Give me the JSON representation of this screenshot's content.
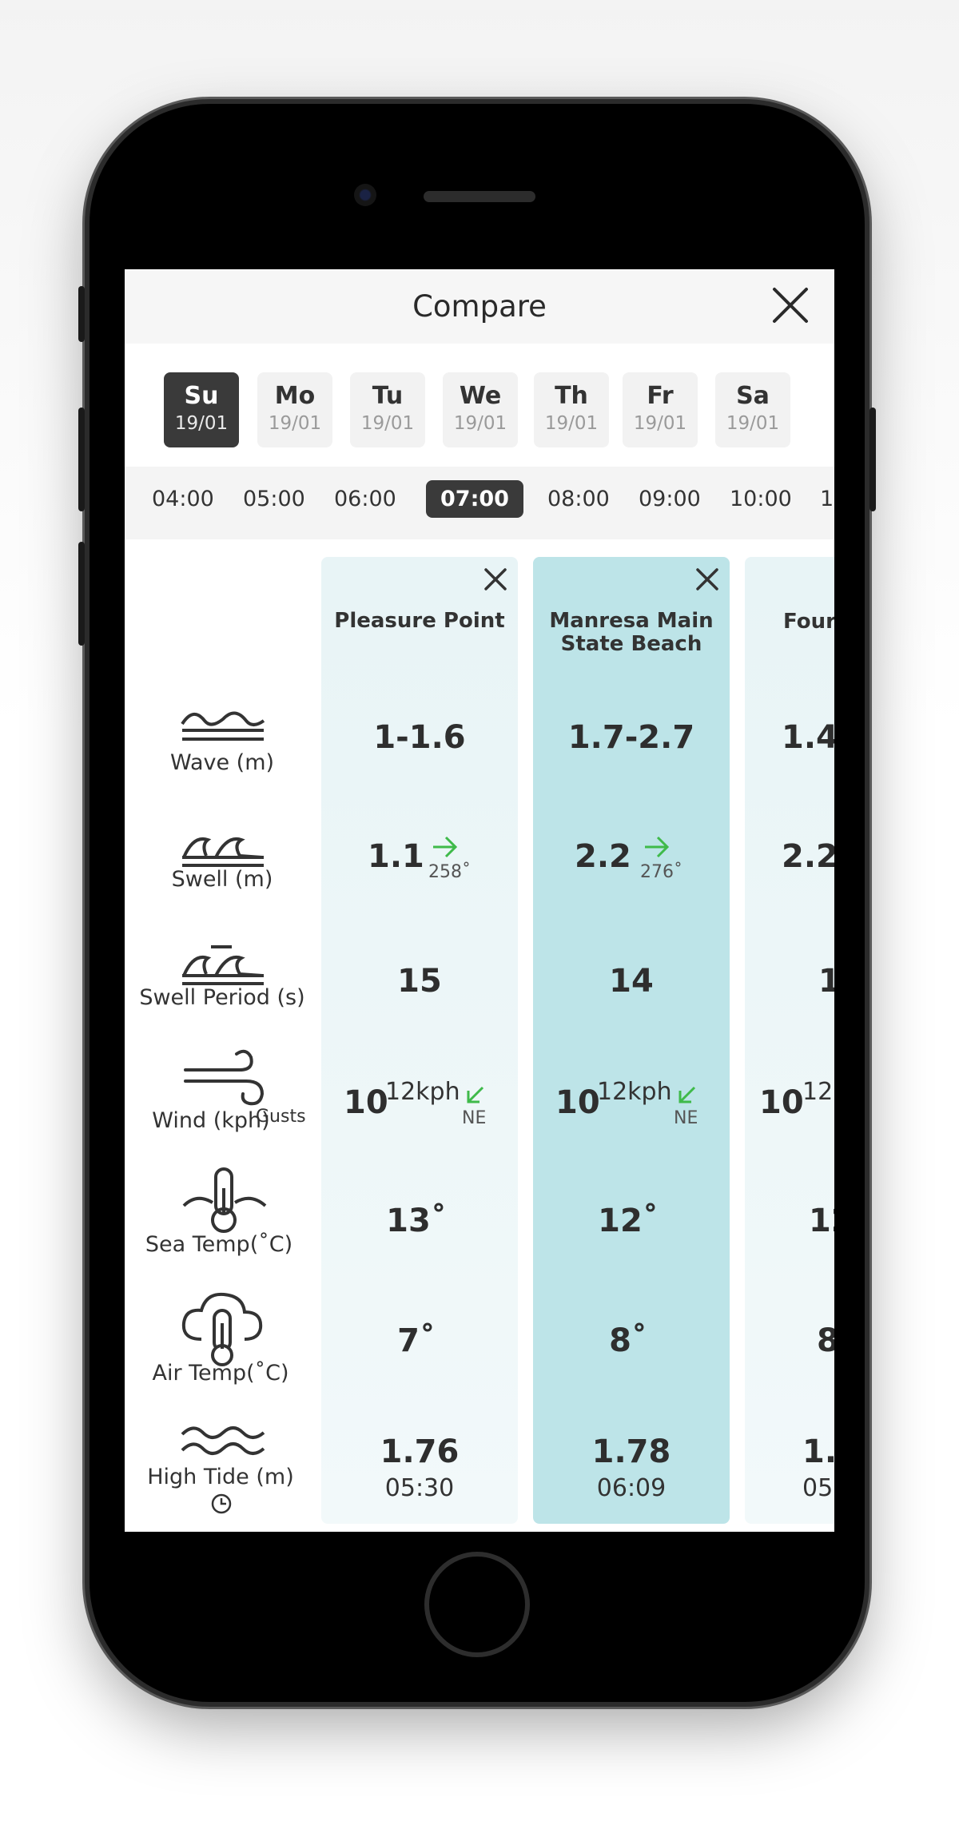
{
  "header": {
    "title": "Compare"
  },
  "days": [
    {
      "name": "Su",
      "date": "19/01",
      "active": true
    },
    {
      "name": "Mo",
      "date": "19/01"
    },
    {
      "name": "Tu",
      "date": "19/01"
    },
    {
      "name": "We",
      "date": "19/01"
    },
    {
      "name": "Th",
      "date": "19/01"
    },
    {
      "name": "Fr",
      "date": "19/01"
    },
    {
      "name": "Sa",
      "date": "19/01"
    }
  ],
  "times": [
    "04:00",
    "05:00",
    "06:00",
    "07:00",
    "08:00",
    "09:00",
    "10:00",
    "1"
  ],
  "active_time": "07:00",
  "rows": {
    "wave": "Wave (m)",
    "swell": "Swell (m)",
    "period": "Swell Period (s)",
    "wind": "Wind (kph)",
    "wind_gusts": "Gusts",
    "sea_temp": "Sea Temp(˚C)",
    "air_temp": "Air Temp(˚C)",
    "tide": "High Tide (m)"
  },
  "spots": [
    {
      "name": "Pleasure Point",
      "wave": "1-1.6",
      "swell": "1.1",
      "swell_dir": "258˚",
      "period": "15",
      "wind": "10",
      "gusts": "12kph",
      "wind_dir": "NE",
      "sea_temp": "13˚",
      "air_temp": "7˚",
      "tide": "1.76",
      "tide_time": "05:30"
    },
    {
      "name": "Manresa Main State Beach",
      "name_line1": "Manresa Main",
      "name_line2": "State Beach",
      "wave": "1.7-2.7",
      "swell": "2.2",
      "swell_dir": "276˚",
      "period": "14",
      "wind": "10",
      "gusts": "12kph",
      "wind_dir": "NE",
      "sea_temp": "12˚",
      "air_temp": "8˚",
      "tide": "1.78",
      "tide_time": "06:09"
    },
    {
      "name": "Four",
      "wave": "1.4",
      "swell": "2.2",
      "period": "1",
      "wind": "10",
      "gusts": "12",
      "sea_temp": "12",
      "air_temp": "8",
      "tide": "1.",
      "tide_time": "05"
    }
  ],
  "icons": {
    "close": "close-icon",
    "wave": "wave-icon",
    "swell": "swell-icon",
    "period": "swell-period-icon",
    "wind": "wind-icon",
    "sea_temp": "sea-temperature-icon",
    "air_temp": "air-temperature-icon",
    "tide": "tide-icon",
    "clock": "clock-icon",
    "arrow": "direction-arrow-icon"
  },
  "colors": {
    "accent_dark": "#3a3a3a",
    "column_highlight": "#bde4e8",
    "column_light": "#eef7f8",
    "direction_arrow": "#3fba4a"
  }
}
